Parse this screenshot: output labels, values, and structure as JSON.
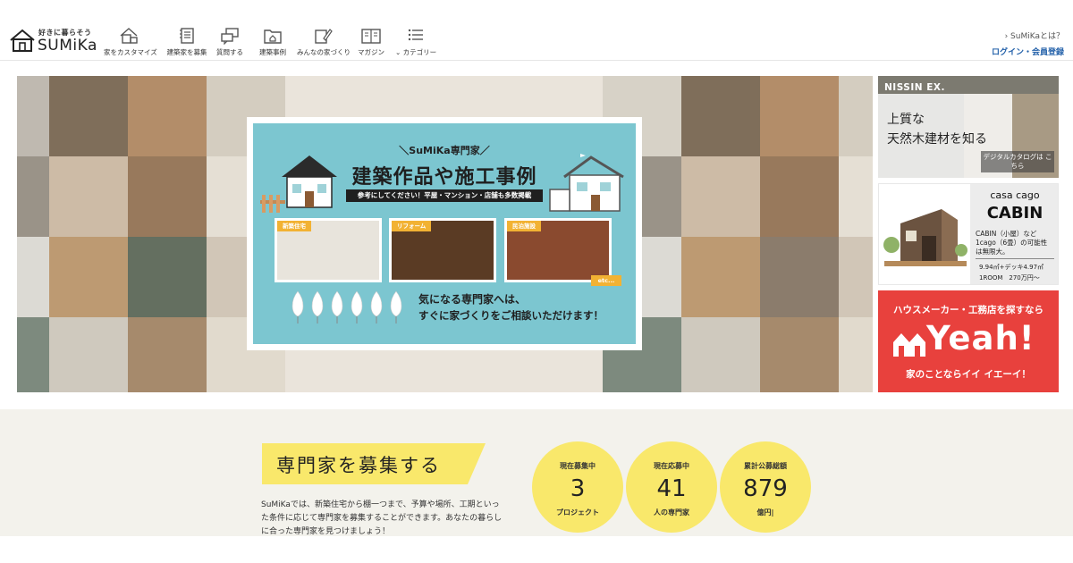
{
  "header": {
    "logo_tagline": "好きに暮らそう",
    "logo_word": "SUMiKa",
    "nav": [
      {
        "label": "家をカスタマイズ",
        "icon": "house-customize-icon"
      },
      {
        "label": "建築家を募集",
        "icon": "notepad-icon"
      },
      {
        "label": "質問する",
        "icon": "chat-bubbles-icon"
      },
      {
        "label": "建築事例",
        "icon": "folder-house-icon"
      },
      {
        "label": "みんなの家づくり",
        "icon": "pen-note-icon"
      },
      {
        "label": "マガジン",
        "icon": "open-book-icon"
      },
      {
        "label": "カテゴリー",
        "icon": "list-icon"
      }
    ],
    "about_link": "› SuMiKaとは？",
    "login_link": "ログイン・会員登録"
  },
  "banner": {
    "subtitle": "＼SuMiKa専門家／",
    "title": "建築作品や施工事例",
    "strip": "参考にしてください！平屋・マンション・店舗も多数掲載",
    "tags": [
      "新築住宅",
      "リフォーム",
      "民泊施設"
    ],
    "etc": "etc...",
    "message_line1": "気になる専門家へは、",
    "message_line2": "すぐに家づくりをご相談いただけます！"
  },
  "ads": {
    "nissin": {
      "brand": "NISSIN EX.",
      "line1": "上質な",
      "line2": "天然木建材を知る",
      "catalog": "デジタルカタログは こちら"
    },
    "casacago": {
      "brand": "casa cago",
      "title": "CABIN",
      "desc1": "CABIN（小屋）など",
      "desc2": "1cago（6畳）の可能性",
      "desc3": "は無限大。",
      "spec1": "9.94㎡+デッキ4.97㎡",
      "spec2": "1ROOM　270万円〜"
    },
    "yeah": {
      "top": "ハウスメーカー・工務店を探すなら",
      "word": "Yeah!",
      "bottom": "家のことならイイ イエーイ！"
    }
  },
  "recruit": {
    "title": "専門家を募集する",
    "desc": "SuMiKaでは、新築住宅から棚一つまで、予算や場所、工期といった条件に応じて専門家を募集することができます。あなたの暮らしに合った専門家を見つけましょう！"
  },
  "stats": [
    {
      "label": "現在募集中",
      "value": "3",
      "unit": "プロジェクト"
    },
    {
      "label": "現在応募中",
      "value": "41",
      "unit": "人の専門家"
    },
    {
      "label": "累計公募総額",
      "value": "879",
      "unit": "億円|"
    }
  ],
  "colors": {
    "accent_yellow": "#f9e86b",
    "link_blue": "#1f5ea8",
    "banner_teal": "#7cc6d0",
    "yeah_red": "#e8413d"
  }
}
